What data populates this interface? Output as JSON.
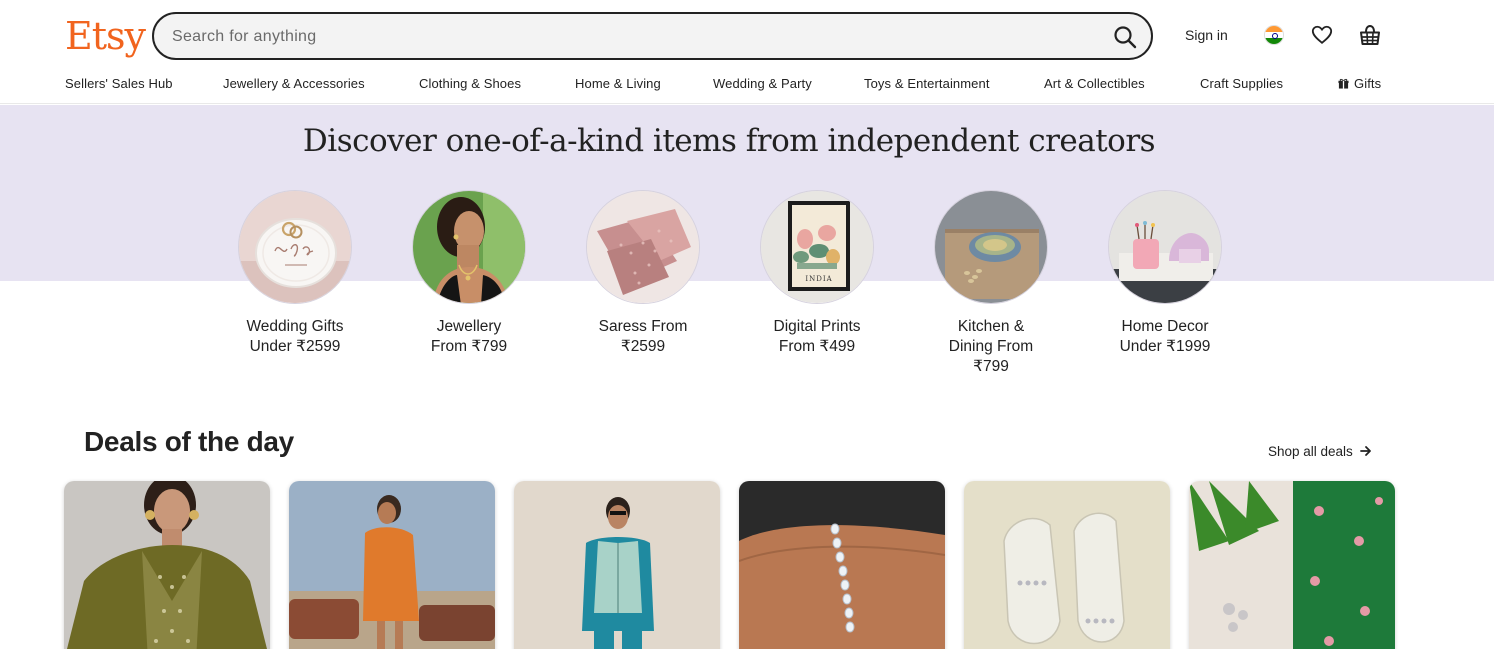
{
  "header": {
    "logo": "Etsy",
    "search_placeholder": "Search for anything",
    "signin_label": "Sign in"
  },
  "nav": [
    {
      "label": "Sellers' Sales Hub"
    },
    {
      "label": "Jewellery & Accessories"
    },
    {
      "label": "Clothing & Shoes"
    },
    {
      "label": "Home & Living"
    },
    {
      "label": "Wedding & Party"
    },
    {
      "label": "Toys & Entertainment"
    },
    {
      "label": "Art & Collectibles"
    },
    {
      "label": "Craft Supplies"
    },
    {
      "label": "Gifts"
    }
  ],
  "hero": {
    "title": "Discover one-of-a-kind items from independent creators",
    "categories": [
      {
        "line1": "Wedding Gifts",
        "line2": "Under ₹2599",
        "line3": ""
      },
      {
        "line1": "Jewellery",
        "line2": "From ₹799",
        "line3": ""
      },
      {
        "line1": "Saress From",
        "line2": "₹2599",
        "line3": ""
      },
      {
        "line1": "Digital Prints",
        "line2": "From ₹499",
        "line3": ""
      },
      {
        "line1": "Kitchen &",
        "line2": "Dining From",
        "line3": "₹799"
      },
      {
        "line1": "Home Decor",
        "line2": "Under ₹1999",
        "line3": ""
      }
    ],
    "print_caption": "INDIA"
  },
  "deals": {
    "title": "Deals of the day",
    "shop_all_label": "Shop all deals"
  },
  "colors": {
    "brand": "#f1641e",
    "hero_bg": "#e7e3f2",
    "text": "#222222"
  },
  "icons": {
    "search": "search-icon",
    "flag": "india-flag-icon",
    "favorites": "heart-icon",
    "cart": "shopping-basket-icon",
    "gifts": "gift-icon",
    "arrow": "arrow-right-icon"
  }
}
